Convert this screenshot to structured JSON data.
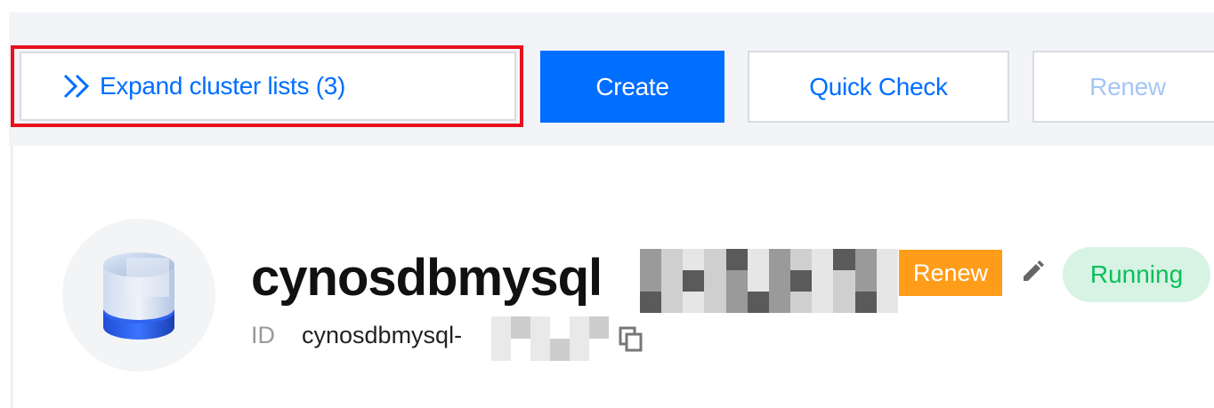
{
  "toolbar": {
    "expand_label": "Expand cluster lists (3)",
    "create_label": "Create",
    "quick_check_label": "Quick Check",
    "renew_label": "Renew"
  },
  "cluster": {
    "name": "cynosdbmysql",
    "renew_badge": "Renew",
    "status": "Running",
    "id_label": "ID",
    "id_value": "cynosdbmysql-"
  },
  "colors": {
    "primary": "#006eff",
    "highlight": "#e8111c",
    "renew_badge": "#ff9c19",
    "running_text": "#0abf5b",
    "running_bg": "#d7f3e3"
  },
  "icons": [
    "double-chevron-right-icon",
    "database-icon",
    "edit-icon",
    "copy-icon"
  ]
}
